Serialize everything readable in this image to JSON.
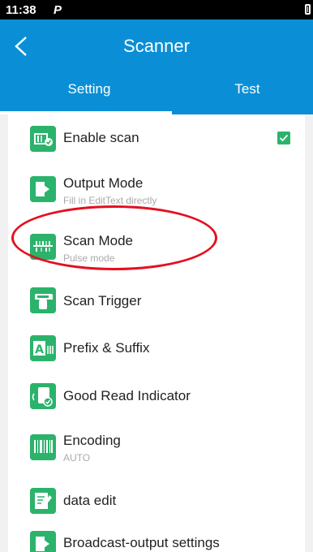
{
  "status_bar": {
    "time": "11:38",
    "notification_icon": "P",
    "battery_icon": "battery-icon"
  },
  "app_bar": {
    "title": "Scanner",
    "back_icon": "chevron-left-icon"
  },
  "tabs": [
    {
      "label": "Setting",
      "selected": true
    },
    {
      "label": "Test",
      "selected": false
    }
  ],
  "settings": [
    {
      "label": "Enable scan",
      "sub": "",
      "icon": "barcode-check-icon",
      "checked": true
    },
    {
      "label": "Output Mode",
      "sub": "Fill in EditText directly",
      "icon": "output-arrow-icon"
    },
    {
      "label": "Scan Mode",
      "sub": "Pulse mode",
      "icon": "scan-mode-icon"
    },
    {
      "label": "Scan Trigger",
      "sub": "",
      "icon": "scan-trigger-icon"
    },
    {
      "label": "Prefix & Suffix",
      "sub": "",
      "icon": "prefix-suffix-icon"
    },
    {
      "label": "Good Read Indicator",
      "sub": "",
      "icon": "good-read-icon"
    },
    {
      "label": "Encoding",
      "sub": "AUTO",
      "icon": "encoding-barcode-icon"
    },
    {
      "label": "data edit",
      "sub": "",
      "icon": "edit-icon"
    },
    {
      "label": "Broadcast-output settings",
      "sub": "",
      "icon": "broadcast-output-icon"
    }
  ],
  "colors": {
    "accent": "#0a8fd6",
    "icon_green": "#2bb36b",
    "highlight_red": "#e3101f"
  }
}
